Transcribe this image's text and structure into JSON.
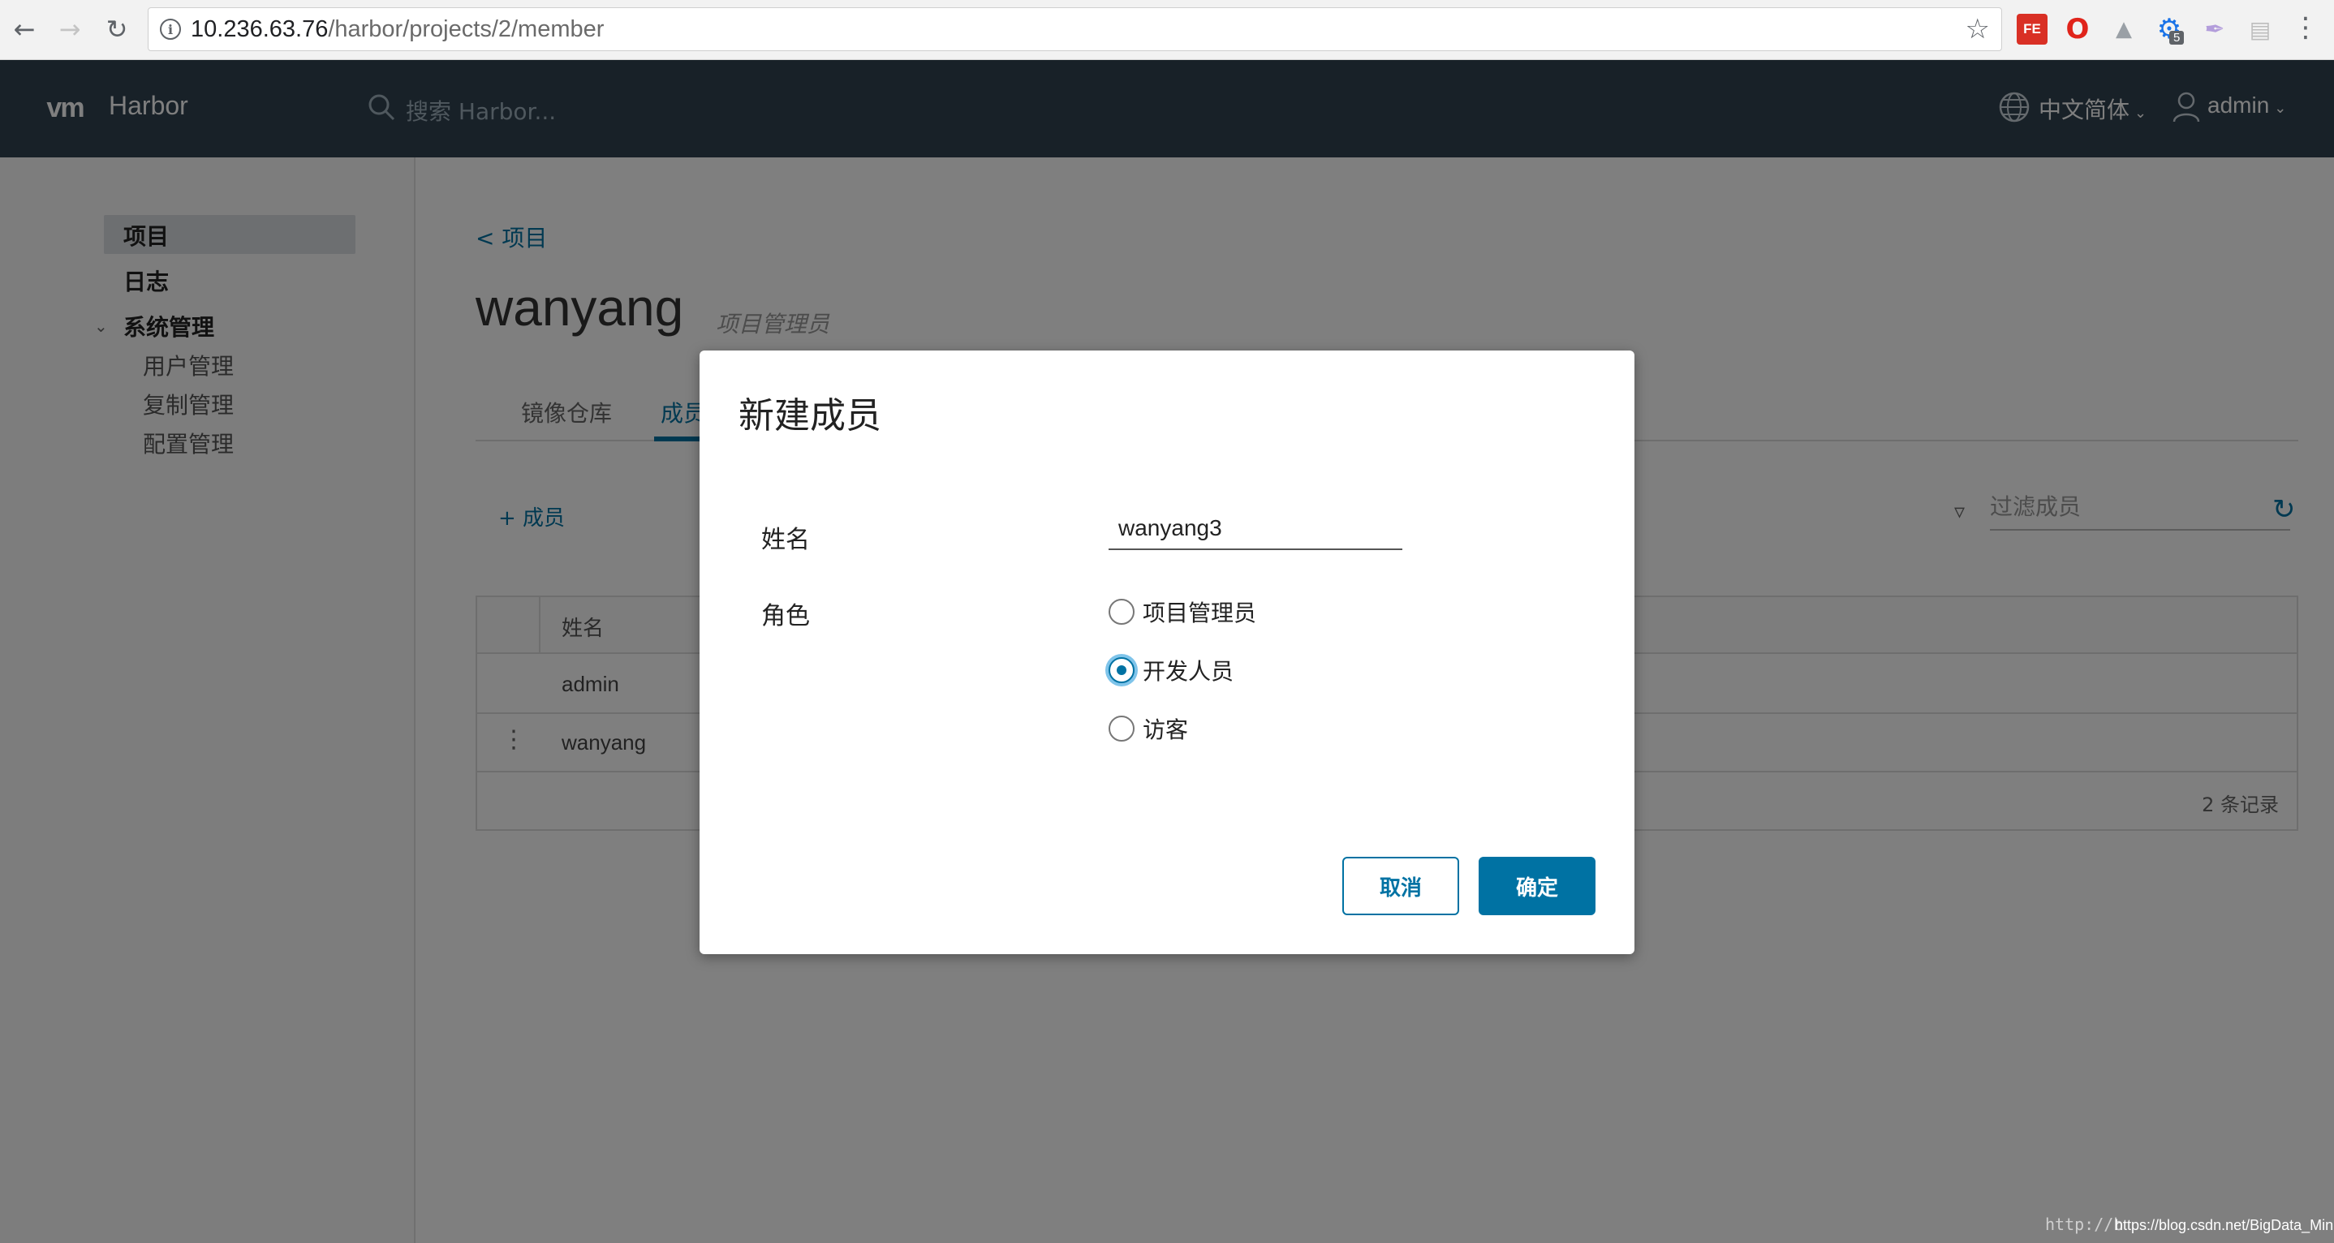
{
  "browser": {
    "url_host": "10.236.63.76",
    "url_path": "/harbor/projects/2/member",
    "extensions": [
      {
        "name": "fe-extension-icon",
        "label": "FE"
      },
      {
        "name": "opera-icon"
      },
      {
        "name": "sitemap-icon"
      },
      {
        "name": "gear-extension-icon",
        "badge": "5"
      },
      {
        "name": "pen-icon"
      },
      {
        "name": "layout-icon"
      }
    ]
  },
  "header": {
    "logo": "vm",
    "app_name": "Harbor",
    "search_placeholder": "搜索 Harbor...",
    "language": "中文简体",
    "user": "admin"
  },
  "sidebar": {
    "items": [
      {
        "label": "项目",
        "active": true
      },
      {
        "label": "日志"
      },
      {
        "label": "系统管理"
      }
    ],
    "sub_items": [
      {
        "label": "用户管理"
      },
      {
        "label": "复制管理"
      },
      {
        "label": "配置管理"
      }
    ]
  },
  "main": {
    "breadcrumb": "< 项目",
    "project_name": "wanyang",
    "project_role": "项目管理员",
    "tabs": [
      {
        "label": "镜像仓库"
      },
      {
        "label": "成员",
        "active": true
      }
    ],
    "add_member": "+ 成员",
    "filter_placeholder": "过滤成员",
    "grid": {
      "column_name": "姓名",
      "rows": [
        {
          "name": "admin"
        },
        {
          "name": "wanyang"
        }
      ],
      "footer": "2 条记录"
    }
  },
  "modal": {
    "title": "新建成员",
    "name_label": "姓名",
    "name_value": "wanyang3",
    "role_label": "角色",
    "roles": [
      {
        "label": "项目管理员",
        "checked": false
      },
      {
        "label": "开发人员",
        "checked": true
      },
      {
        "label": "访客",
        "checked": false
      }
    ],
    "cancel": "取消",
    "ok": "确定"
  },
  "watermark": "http://b",
  "watermark2": "https://blog.csdn.net/BigData_Mining",
  "colors": {
    "header_bg": "#314351",
    "accent": "#0072a3"
  }
}
